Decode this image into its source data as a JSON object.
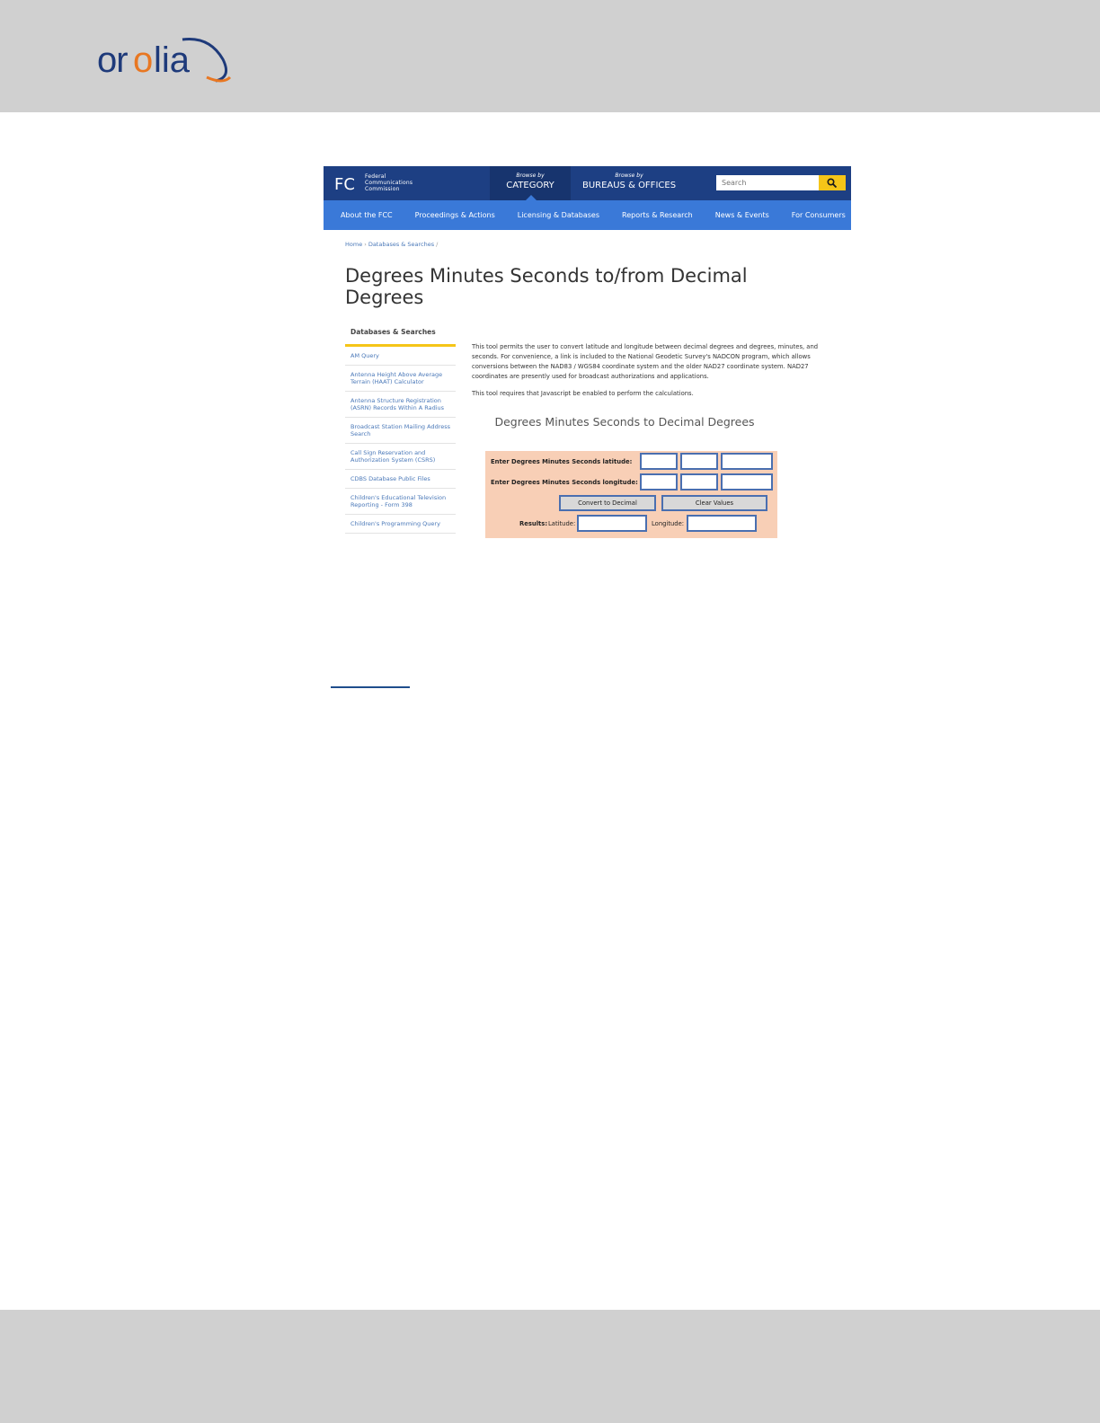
{
  "document": {
    "logo_text": "orolia"
  },
  "fcc": {
    "agency_name": [
      "Federal",
      "Communications",
      "Commission"
    ],
    "browse_category": {
      "small": "Browse by",
      "big": "CATEGORY"
    },
    "browse_bureaus": {
      "small": "Browse by",
      "big": "BUREAUS & OFFICES"
    },
    "search": {
      "placeholder": "Search",
      "button_icon": "search-icon"
    },
    "nav": [
      "About the FCC",
      "Proceedings & Actions",
      "Licensing & Databases",
      "Reports & Research",
      "News & Events",
      "For Consumers"
    ],
    "breadcrumb": [
      "Home",
      "Databases & Searches"
    ],
    "page_title": "Degrees Minutes Seconds to/from Decimal Degrees",
    "sidebar": {
      "heading": "Databases & Searches",
      "items": [
        "AM Query",
        "Antenna Height Above Average Terrain (HAAT) Calculator",
        "Antenna Structure Registration (ASRN) Records Within A Radius",
        "Broadcast Station Mailing Address Search",
        "Call Sign Reservation and Authorization System (CSRS)",
        "CDBS Database Public Files",
        "Children's Educational Television Reporting - Form 398",
        "Children's Programming Query"
      ]
    },
    "intro": "This tool permits the user to convert latitude and longitude between decimal degrees and degrees, minutes, and seconds.  For convenience, a link is included to the National Geodetic Survey's NADCON program, which allows conversions between the NAD83 / WGS84 coordinate system and the older NAD27 coordinate system.  NAD27 coordinates are presently used for broadcast authorizations and applications.",
    "intro2": "This tool requires that Javascript be enabled to perform the calculations.",
    "tool_title": "Degrees Minutes Seconds to Decimal Degrees",
    "calculator": {
      "lat_label": "Enter Degrees Minutes Seconds latitude:",
      "lon_label": "Enter Degrees Minutes Seconds longitude:",
      "convert_button": "Convert to Decimal",
      "clear_button": "Clear Values",
      "results_label": "Results:",
      "latitude_label": "Latitude:",
      "longitude_label": "Longitude:"
    }
  }
}
